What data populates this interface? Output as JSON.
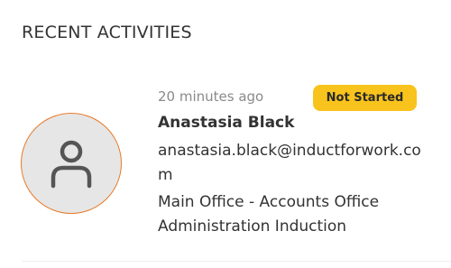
{
  "section": {
    "title": "RECENT ACTIVITIES"
  },
  "activity": {
    "avatar_icon": "user-icon",
    "time": "20 minutes ago",
    "status": "Not Started",
    "status_color": "#f8c31c",
    "avatar_border_color": "#e87a2a",
    "name": "Anastasia Black",
    "email": "anastasia.black@inductforwork.com",
    "course_line_1": "Main Office - Accounts Office",
    "course_line_2": "Administration Induction"
  }
}
